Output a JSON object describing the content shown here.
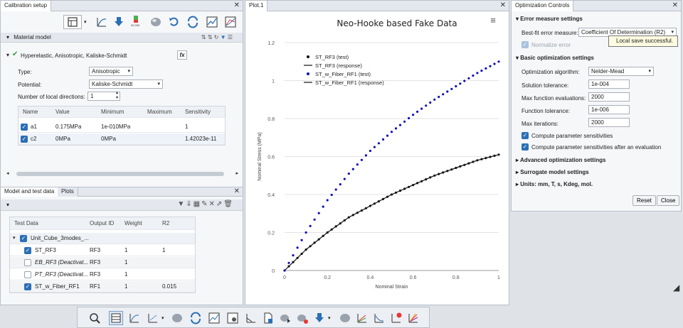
{
  "left_panel": {
    "tab": "Calibration setup",
    "material_model": {
      "title": "Material model",
      "model_name": "Hyperelastic, Anisotropic, Kaliske-Schmidt",
      "type_label": "Type:",
      "type_value": "Anisotropic",
      "potential_label": "Potential:",
      "potential_value": "Kaliske-Schmidt",
      "local_dirs_label": "Number of local directions:",
      "local_dirs_value": "1",
      "columns": [
        "Name",
        "Value",
        "Minimum",
        "Maximum",
        "Sensitivity"
      ],
      "rows": [
        {
          "name": "a1",
          "value": "0.175MPa",
          "minimum": "1e-010MPa",
          "maximum": "",
          "sensitivity": "1"
        },
        {
          "name": "c2",
          "value": "0MPa",
          "minimum": "0MPa",
          "maximum": "",
          "sensitivity": "1.42023e-11"
        }
      ]
    },
    "bottom_tabs": [
      "Model and test data",
      "Plots"
    ],
    "test_columns": [
      "Test Data",
      "Output ID",
      "Weight",
      "R2"
    ],
    "group_name": "Unit_Cube_3modes_...",
    "test_rows": [
      {
        "name": "ST_RF3",
        "output": "RF3",
        "weight": "1",
        "r2": "1",
        "checked": true
      },
      {
        "name": "EB_RF3 (Deactivat...",
        "output": "RF3",
        "weight": "1",
        "r2": "",
        "checked": false
      },
      {
        "name": "PT_RF3 (Deactivat...",
        "output": "RF3",
        "weight": "1",
        "r2": "",
        "checked": false
      },
      {
        "name": "ST_w_Fiber_RF1",
        "output": "RF1",
        "weight": "1",
        "r2": "0.015",
        "checked": true
      }
    ]
  },
  "plot_panel": {
    "tab": "Plot.1"
  },
  "chart_data": {
    "type": "scatter",
    "title": "Neo-Hooke based Fake Data",
    "xlabel": "Nominal Strain",
    "ylabel": "Nominal Stress (MPa)",
    "xlim": [
      0,
      1
    ],
    "ylim": [
      0,
      1.2
    ],
    "x_ticks": [
      "0",
      "0.2",
      "0.4",
      "0.6",
      "0.8",
      "1"
    ],
    "y_ticks": [
      "0",
      "0.2",
      "0.4",
      "0.6",
      "0.8",
      "1",
      "1.2"
    ],
    "legend": [
      "ST_RF3 (test)",
      "ST_RF3 (response)",
      "ST_w_Fiber_RF1 (test)",
      "ST_w_Fiber_RF1 (response)"
    ],
    "series": [
      {
        "name": "ST_RF3 (test)",
        "color": "#111111",
        "x": [
          0,
          0.1,
          0.2,
          0.3,
          0.4,
          0.5,
          0.6,
          0.7,
          0.8,
          0.9,
          1.0
        ],
        "y": [
          0,
          0.11,
          0.2,
          0.28,
          0.34,
          0.4,
          0.45,
          0.5,
          0.54,
          0.58,
          0.61
        ]
      },
      {
        "name": "ST_w_Fiber_RF1 (test)",
        "color": "#1010b8",
        "x": [
          0,
          0.1,
          0.2,
          0.3,
          0.4,
          0.5,
          0.6,
          0.7,
          0.8,
          0.9,
          1.0
        ],
        "y": [
          0,
          0.2,
          0.37,
          0.51,
          0.63,
          0.73,
          0.82,
          0.9,
          0.97,
          1.04,
          1.1
        ]
      }
    ]
  },
  "right_panel": {
    "tab": "Optimization Controls",
    "error_section": "Error measure settings",
    "best_fit_label": "Best-fit error measure:",
    "best_fit_value": "Coefficient Of Determination (R2)",
    "normalize_label": "Normalize error",
    "tooltip": "Local save successful.",
    "basic_section": "Basic optimization settings",
    "algorithm_label": "Optimization algorithm:",
    "algorithm_value": "Nelder-Mead",
    "fields": [
      {
        "label": "Solution tolerance:",
        "value": "1e-004"
      },
      {
        "label": "Max function evaluations:",
        "value": "2000"
      },
      {
        "label": "Function tolerance:",
        "value": "1e-006"
      },
      {
        "label": "Max iterations:",
        "value": "2000"
      }
    ],
    "sens_label": "Compute parameter sensitivities",
    "sens_after_label": "Compute parameter sensitivities after an evaluation",
    "advanced_section": "Advanced optimization settings",
    "surrogate_section": "Surrogate model settings",
    "units_section": "Units: mm, T, s, Kdeg, mol.",
    "reset": "Reset",
    "close": "Close"
  },
  "icons": {
    "colors": {
      "accent": "#2b6fb6",
      "fiber": "#1010b8"
    }
  }
}
